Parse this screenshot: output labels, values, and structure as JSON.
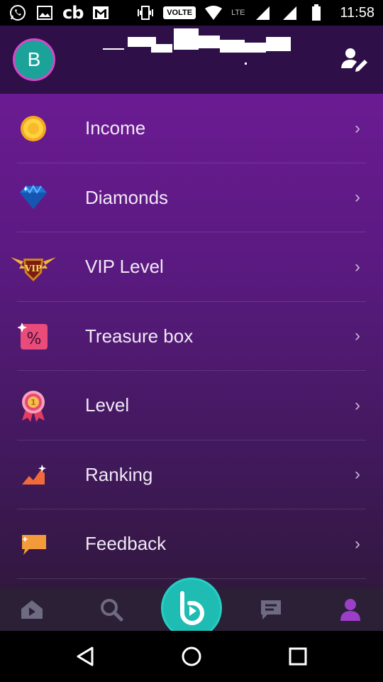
{
  "status_bar": {
    "cb_text": "cb",
    "volte": "VOLTE",
    "lte": "LTE",
    "time": "11:58"
  },
  "header": {
    "avatar_letter": "B"
  },
  "menu": {
    "items": [
      {
        "label": "Income",
        "icon": "coin-icon"
      },
      {
        "label": "Diamonds",
        "icon": "diamond-icon"
      },
      {
        "label": "VIP Level",
        "icon": "vip-badge-icon"
      },
      {
        "label": "Treasure box",
        "icon": "treasure-box-icon"
      },
      {
        "label": "Level",
        "icon": "medal-icon"
      },
      {
        "label": "Ranking",
        "icon": "ranking-icon"
      },
      {
        "label": "Feedback",
        "icon": "feedback-icon"
      }
    ],
    "chevron": "›"
  },
  "bottom_nav": {
    "items": [
      "home-icon",
      "search-icon",
      "live-play-icon",
      "chat-icon",
      "profile-icon"
    ],
    "active": "profile-icon",
    "accent_color": "#9b3fc9",
    "play_color": "#1ebcb3"
  },
  "colors": {
    "header_bg": "#2e0f48",
    "menu_top": "#6b1b92",
    "menu_bottom": "#32183f"
  }
}
